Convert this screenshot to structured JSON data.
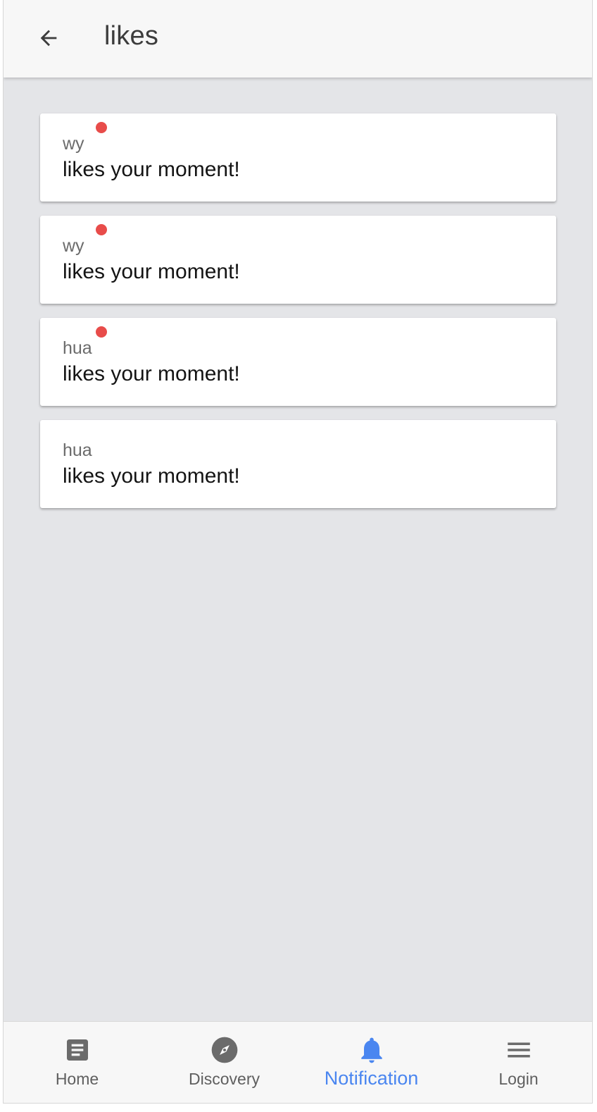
{
  "header": {
    "title": "likes",
    "back_icon": "arrow-left-icon"
  },
  "notifications": [
    {
      "user": "wy",
      "message": "likes your moment!",
      "unread": true
    },
    {
      "user": "wy",
      "message": "likes your moment!",
      "unread": true
    },
    {
      "user": "hua",
      "message": "likes your moment!",
      "unread": true
    },
    {
      "user": "hua",
      "message": "likes your moment!",
      "unread": false
    }
  ],
  "bottom_nav": {
    "items": [
      {
        "label": "Home",
        "icon": "article-icon",
        "active": false
      },
      {
        "label": "Discovery",
        "icon": "compass-icon",
        "active": false
      },
      {
        "label": "Notification",
        "icon": "bell-icon",
        "active": true
      },
      {
        "label": "Login",
        "icon": "menu-icon",
        "active": false
      }
    ]
  },
  "colors": {
    "background": "#e4e5e8",
    "bar": "#f7f7f7",
    "unread_dot": "#e84c4a",
    "active_tab": "#4a86f0",
    "inactive_icon": "#6b6b6b"
  }
}
